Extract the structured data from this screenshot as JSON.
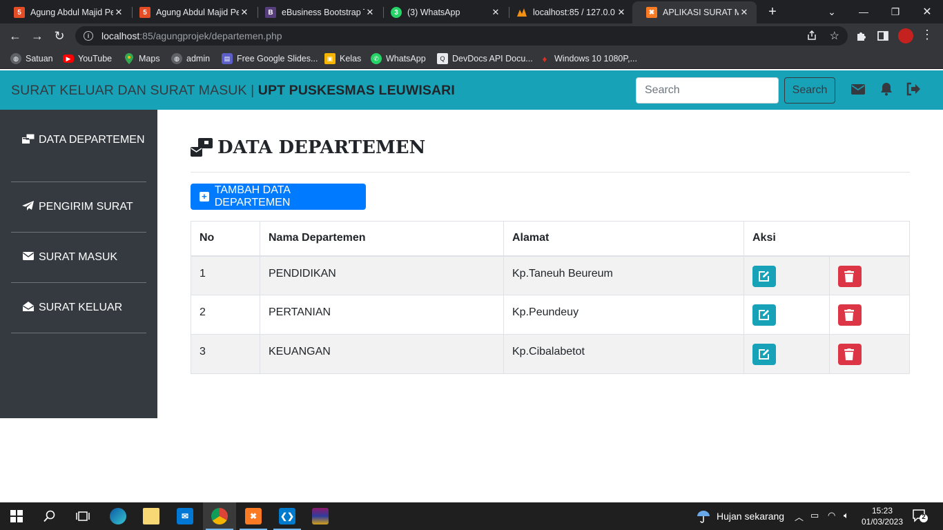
{
  "browser": {
    "tabs": [
      {
        "title": "Agung Abdul Majid Pe",
        "icon": "html5-icon",
        "color": "#e44d26"
      },
      {
        "title": "Agung Abdul Majid Pe",
        "icon": "html5-icon",
        "color": "#e44d26"
      },
      {
        "title": "eBusiness Bootstrap T",
        "icon": "bootstrap-icon",
        "color": "#563d7c",
        "glyph": "B"
      },
      {
        "title": "(3) WhatsApp",
        "icon": "whatsapp-icon",
        "color": "#25d366",
        "glyph": "3"
      },
      {
        "title": "localhost:85 / 127.0.0.",
        "icon": "phpmyadmin-icon",
        "color": "#f29111"
      },
      {
        "title": "APLIKASI SURAT MASU",
        "icon": "xampp-icon",
        "color": "#fb7a24",
        "active": true
      }
    ],
    "url_host": "localhost",
    "url_path": ":85/agungprojek/departemen.php",
    "bookmarks": [
      {
        "label": "Satuan",
        "icon": "globe-icon",
        "color": "#5f6368"
      },
      {
        "label": "YouTube",
        "icon": "youtube-icon",
        "color": "#ff0000"
      },
      {
        "label": "Maps",
        "icon": "maps-icon",
        "color": "#34a853"
      },
      {
        "label": "admin",
        "icon": "globe-icon",
        "color": "#5f6368"
      },
      {
        "label": "Free Google Slides...",
        "icon": "slides-icon",
        "color": "#5b5fc7"
      },
      {
        "label": "Kelas",
        "icon": "classroom-icon",
        "color": "#f4b400"
      },
      {
        "label": "WhatsApp",
        "icon": "whatsapp-icon",
        "color": "#25d366"
      },
      {
        "label": "DevDocs API Docu...",
        "icon": "devdocs-icon",
        "color": "#e8eaed"
      },
      {
        "label": "Windows 10 1080P,...",
        "icon": "flame-icon",
        "color": "#d93025"
      }
    ]
  },
  "navbar": {
    "brand_prefix": "SURAT KELUAR DAN SURAT MASUK | ",
    "brand_bold": "UPT PUSKESMAS LEUWISARI",
    "search_placeholder": "Search",
    "search_button": "Search"
  },
  "sidebar": {
    "items": [
      {
        "label": "DATA DEPARTEMEN",
        "icon": "mail-bulk-icon"
      },
      {
        "label": "PENGIRIM SURAT",
        "icon": "paper-plane-icon"
      },
      {
        "label": "SURAT MASUK",
        "icon": "envelope-icon"
      },
      {
        "label": "SURAT KELUAR",
        "icon": "envelope-open-icon"
      }
    ]
  },
  "main": {
    "title": "DATA DEPARTEMEN",
    "add_button": "TAMBAH DATA DEPARTEMEN",
    "table": {
      "headers": [
        "No",
        "Nama Departemen",
        "Alamat",
        "Aksi"
      ],
      "rows": [
        {
          "no": "1",
          "nama": "PENDIDIKAN",
          "alamat": "Kp.Taneuh Beureum"
        },
        {
          "no": "2",
          "nama": "PERTANIAN",
          "alamat": "Kp.Peundeuy"
        },
        {
          "no": "3",
          "nama": "KEUANGAN",
          "alamat": "Kp.Cibalabetot"
        }
      ]
    }
  },
  "taskbar": {
    "weather": "Hujan sekarang",
    "time": "15:23",
    "date": "01/03/2023",
    "notifications": "2"
  },
  "colors": {
    "navbar": "#17a2b8",
    "sidebar": "#343a40",
    "primary": "#007bff",
    "danger": "#dc3545"
  }
}
